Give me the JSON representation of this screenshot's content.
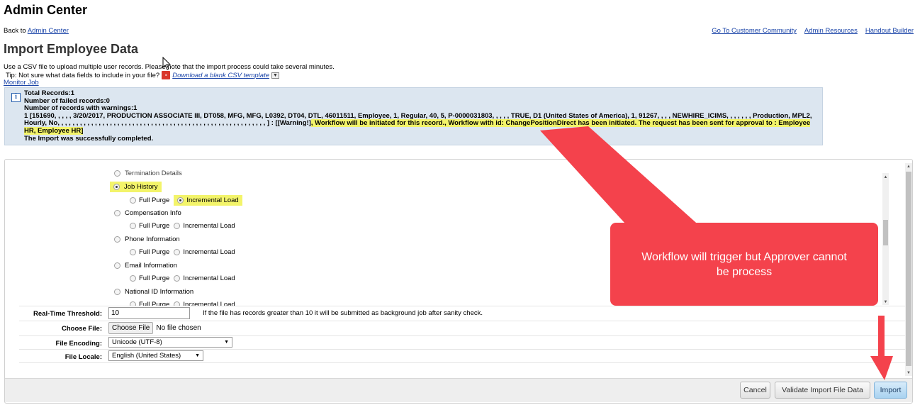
{
  "header": {
    "app_title": "Admin Center",
    "back_prefix": "Back to ",
    "back_link": "Admin Center",
    "top_links": [
      "Go To Customer Community",
      "Admin Resources",
      "Handout Builder"
    ]
  },
  "page": {
    "title": "Import Employee Data",
    "description": "Use a CSV file to upload multiple user records. Please note that the import process could take several minutes.",
    "tip_prefix": "Tip: Not sure what data fields to include in your file?",
    "tip_link": "Download a blank CSV template",
    "monitor_link": "Monitor Job"
  },
  "message": {
    "total": "Total Records:1",
    "failed": "Number of failed records:0",
    "warnings": "Number of records with warnings:1",
    "record_line": "1 [151690, , , , , 3/20/2017, PRODUCTION ASSOCIATE III, DT058, MFG, MFG, L0392, DT04, DTL, 46011511, Employee, 1, Regular, 40, 5, P-0000031803, , , , , TRUE, D1 (United States of America), 1, 91267, , , , NEWHIRE_ICIMS, , , , , , , Production, MPL2, Hourly, No, , , , , , , , , , , , , , , , , , , , , , , , , , , , , , , , , , , , , , , , , , , , , , , , , , , , , , , , ] : [[Warning!]",
    "highlight_text": ", Workflow will be initiated for this record., Workflow with id: ChangePositionDirect has been initiated. The request has been sent for approval to : Employee HR, Employee HR]",
    "success": "The Import was successfully completed."
  },
  "options": {
    "cut_top_label": "Termination Details",
    "full_purge": "Full Purge",
    "incremental_load": "Incremental Load",
    "items": [
      {
        "label": "Job History",
        "checked": true
      },
      {
        "label": "Compensation Info",
        "checked": false
      },
      {
        "label": "Phone Information",
        "checked": false
      },
      {
        "label": "Email Information",
        "checked": false
      },
      {
        "label": "National ID Information",
        "checked": false
      }
    ]
  },
  "form": {
    "threshold_label": "Real-Time Threshold:",
    "threshold_value": "10",
    "threshold_note": "If the file has records greater than 10 it will be submitted as background job after sanity check.",
    "file_label": "Choose File:",
    "file_button": "Choose File",
    "file_status": "No file chosen",
    "encoding_label": "File Encoding:",
    "encoding_value": "Unicode (UTF-8)",
    "locale_label": "File Locale:",
    "locale_value": "English (United States)"
  },
  "buttons": {
    "cancel": "Cancel",
    "validate": "Validate Import File Data",
    "import": "Import"
  },
  "annotation": {
    "callout_text": "Workflow will trigger but Approver cannot be process",
    "color": "#f4424c"
  }
}
